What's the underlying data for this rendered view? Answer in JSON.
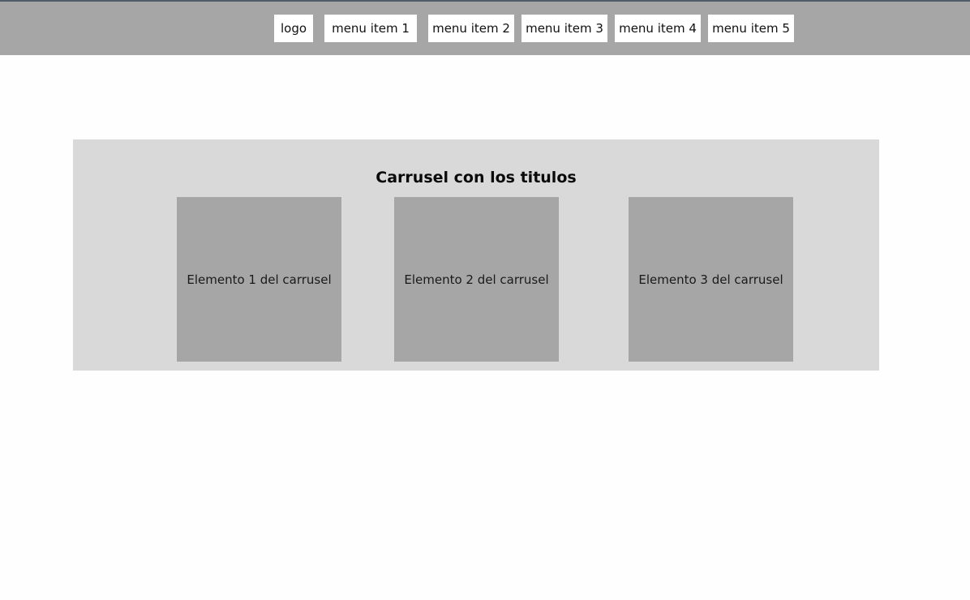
{
  "header": {
    "logo": "logo",
    "menu_items": [
      "menu item 1",
      "menu item 2",
      "menu item 3",
      "menu item 4",
      "menu item 5"
    ]
  },
  "carousel": {
    "title": "Carrusel con los titulos",
    "slides": [
      "Elemento 1 del carrusel",
      "Elemento 2 del carrusel",
      "Elemento 3 del carrusel"
    ]
  },
  "colors": {
    "header_bg": "#a6a6a6",
    "carousel_bg": "#d9d9d9",
    "slide_bg": "#a6a6a6",
    "top_border": "#4f5b66"
  }
}
